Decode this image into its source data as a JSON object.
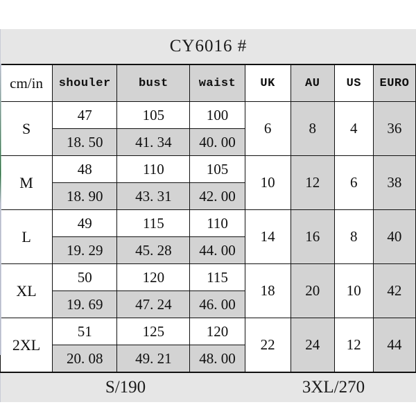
{
  "title": "CY6016 #",
  "table": {
    "headers": [
      {
        "label": "cm/in",
        "style": "serif",
        "shaded": false
      },
      {
        "label": "shouler",
        "style": "mono",
        "shaded": true
      },
      {
        "label": "bust",
        "style": "mono",
        "shaded": true
      },
      {
        "label": "waist",
        "style": "mono",
        "shaded": true
      },
      {
        "label": "UK",
        "style": "mono",
        "shaded": false
      },
      {
        "label": "AU",
        "style": "mono",
        "shaded": true
      },
      {
        "label": "US",
        "style": "mono",
        "shaded": false
      },
      {
        "label": "EURO",
        "style": "mono",
        "shaded": true
      }
    ],
    "rows": [
      {
        "size": "S",
        "shoulder_cm": "47",
        "bust_cm": "105",
        "waist_cm": "100",
        "shoulder_in": "18. 50",
        "bust_in": "41. 34",
        "waist_in": "40. 00",
        "uk": "6",
        "au": "8",
        "us": "4",
        "euro": "36"
      },
      {
        "size": "M",
        "shoulder_cm": "48",
        "bust_cm": "110",
        "waist_cm": "105",
        "shoulder_in": "18. 90",
        "bust_in": "43. 31",
        "waist_in": "42. 00",
        "uk": "10",
        "au": "12",
        "us": "6",
        "euro": "38"
      },
      {
        "size": "L",
        "shoulder_cm": "49",
        "bust_cm": "115",
        "waist_cm": "110",
        "shoulder_in": "19. 29",
        "bust_in": "45. 28",
        "waist_in": "44. 00",
        "uk": "14",
        "au": "16",
        "us": "8",
        "euro": "40"
      },
      {
        "size": "XL",
        "shoulder_cm": "50",
        "bust_cm": "120",
        "waist_cm": "115",
        "shoulder_in": "19. 69",
        "bust_in": "47. 24",
        "waist_in": "46. 00",
        "uk": "18",
        "au": "20",
        "us": "10",
        "euro": "42"
      },
      {
        "size": "2XL",
        "shoulder_cm": "51",
        "bust_cm": "125",
        "waist_cm": "120",
        "shoulder_in": "20. 08",
        "bust_in": "49. 21",
        "waist_in": "48. 00",
        "uk": "22",
        "au": "24",
        "us": "12",
        "euro": "44"
      }
    ]
  },
  "footer": {
    "left": "S/190",
    "right": "3XL/270"
  },
  "colors": {
    "band_background": "#e6e6e6",
    "shaded_cell": "#d3d3d3",
    "cell_background": "#ffffff",
    "border": "#111111",
    "text": "#0f0f0f"
  }
}
